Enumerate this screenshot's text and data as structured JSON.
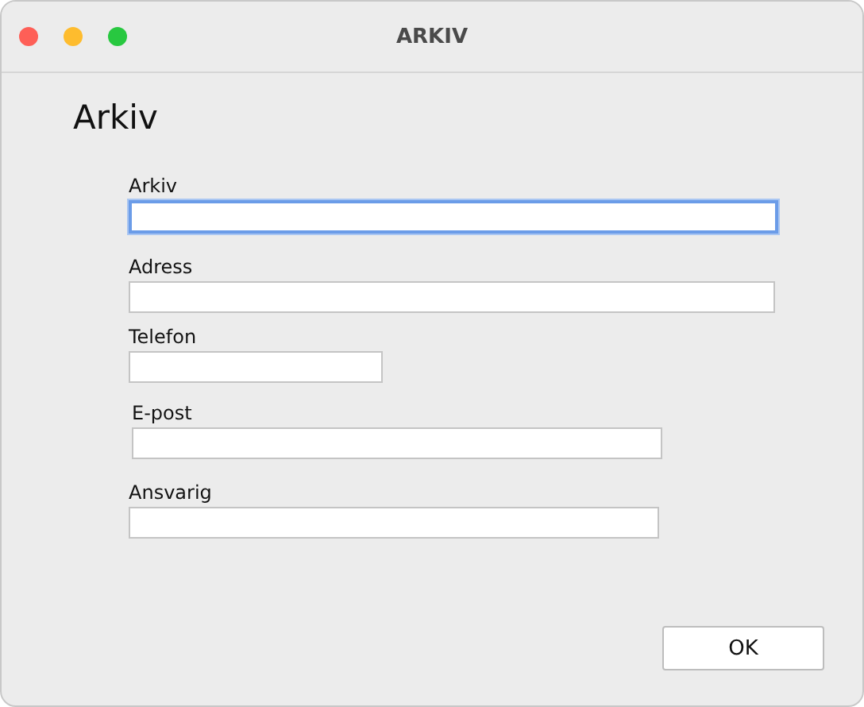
{
  "window": {
    "title": "ARKIV"
  },
  "heading": "Arkiv",
  "fields": [
    {
      "label": "Arkiv",
      "focused": true
    },
    {
      "label": "Adress",
      "focused": false
    },
    {
      "label": "Telefon",
      "focused": false
    },
    {
      "label": "E-post",
      "focused": false
    },
    {
      "label": "Ansvarig",
      "focused": false
    }
  ],
  "buttons": [
    "OK"
  ]
}
